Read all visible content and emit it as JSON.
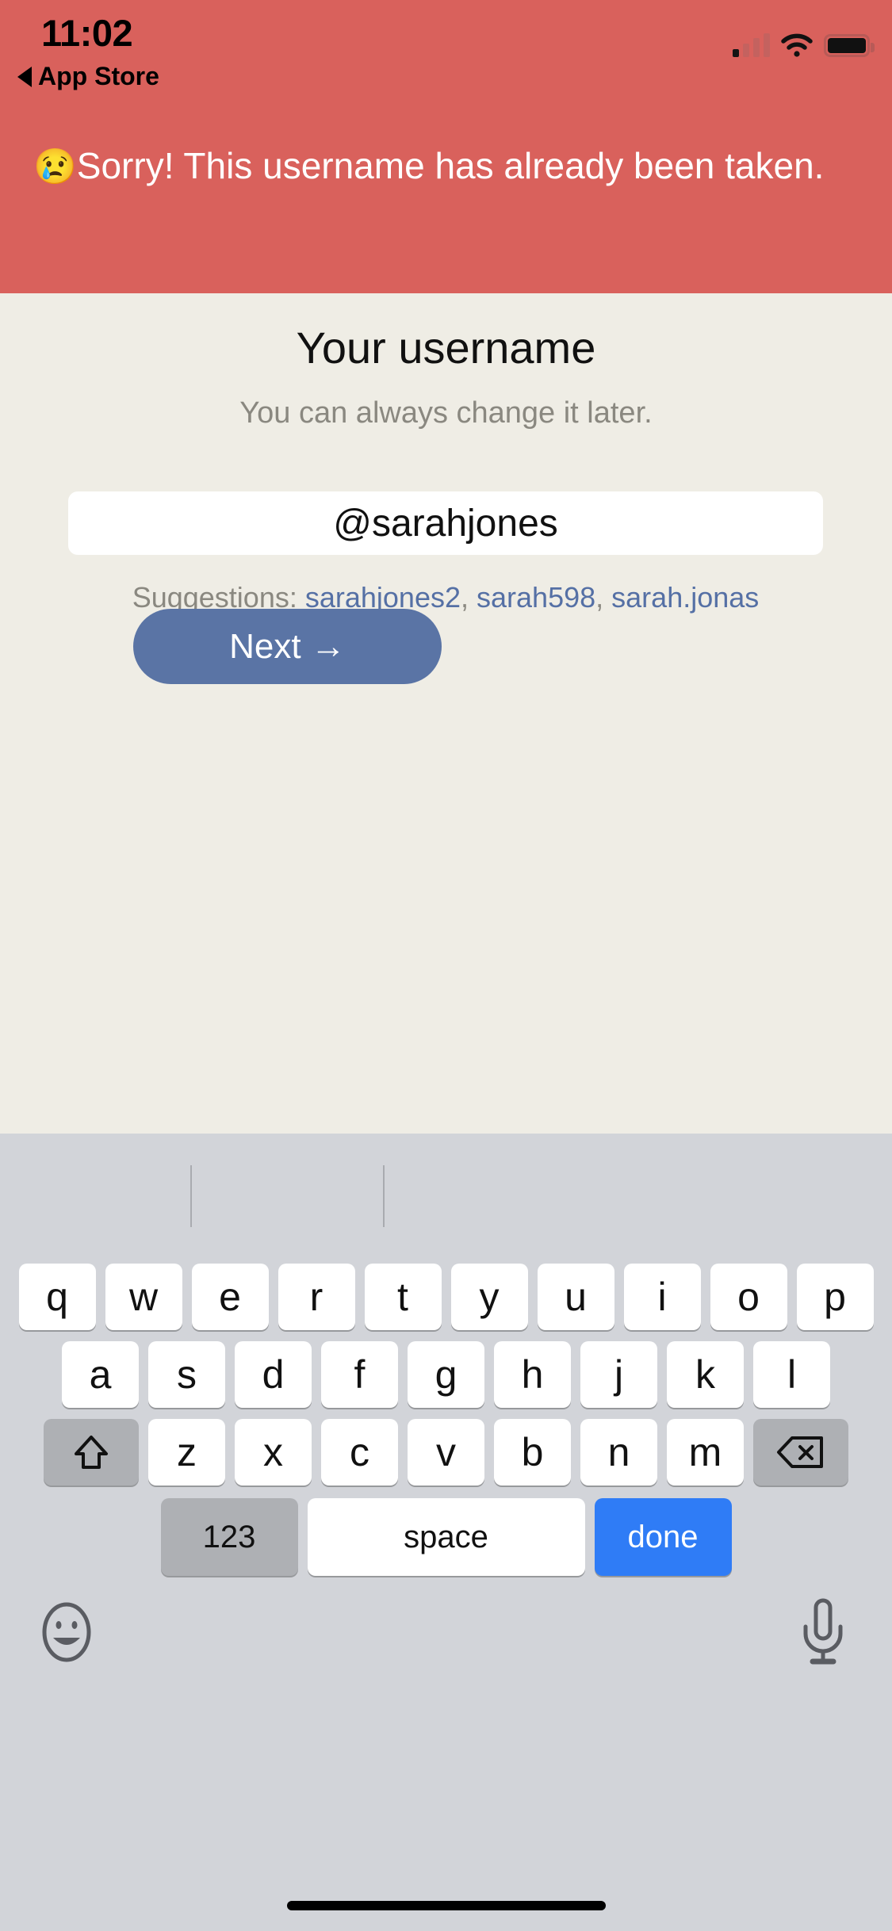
{
  "status_bar": {
    "time": "11:02",
    "back_label": "App Store",
    "back_icon": "back-triangle-icon",
    "cellular_icon": "cellular-signal-icon",
    "cellular_bars_active": 1,
    "cellular_bars_total": 4,
    "wifi_icon": "wifi-icon",
    "battery_icon": "battery-icon"
  },
  "banner": {
    "emoji": "😢",
    "emoji_name": "crying-face-emoji",
    "message": "Sorry! This username has already been taken.",
    "background_color": "#D9615C",
    "text_color": "#FFFFFF"
  },
  "main": {
    "title": "Your username",
    "subtitle": "You can always change it later.",
    "username_value": "@sarahjones",
    "username_placeholder": "@username",
    "suggestions_label": "Suggestions: ",
    "suggestions": [
      "sarahjones2",
      "sarah598",
      "sarah.jonas"
    ],
    "suggestion_separator": ", ",
    "next_label": "Next →",
    "accent_color": "#5A74A5",
    "link_color": "#5570A5",
    "background_color": "#EFEDE5"
  },
  "keyboard": {
    "background_color": "#D2D4D9",
    "rows": [
      [
        "q",
        "w",
        "e",
        "r",
        "t",
        "y",
        "u",
        "i",
        "o",
        "p"
      ],
      [
        "a",
        "s",
        "d",
        "f",
        "g",
        "h",
        "j",
        "k",
        "l"
      ],
      [
        "z",
        "x",
        "c",
        "v",
        "b",
        "n",
        "m"
      ]
    ],
    "shift_icon": "shift-arrow-icon",
    "backspace_icon": "backspace-icon",
    "numeric_label": "123",
    "space_label": "space",
    "done_label": "done",
    "done_color": "#2F7CF6",
    "emoji_icon": "smiley-face-icon",
    "mic_icon": "microphone-icon"
  }
}
